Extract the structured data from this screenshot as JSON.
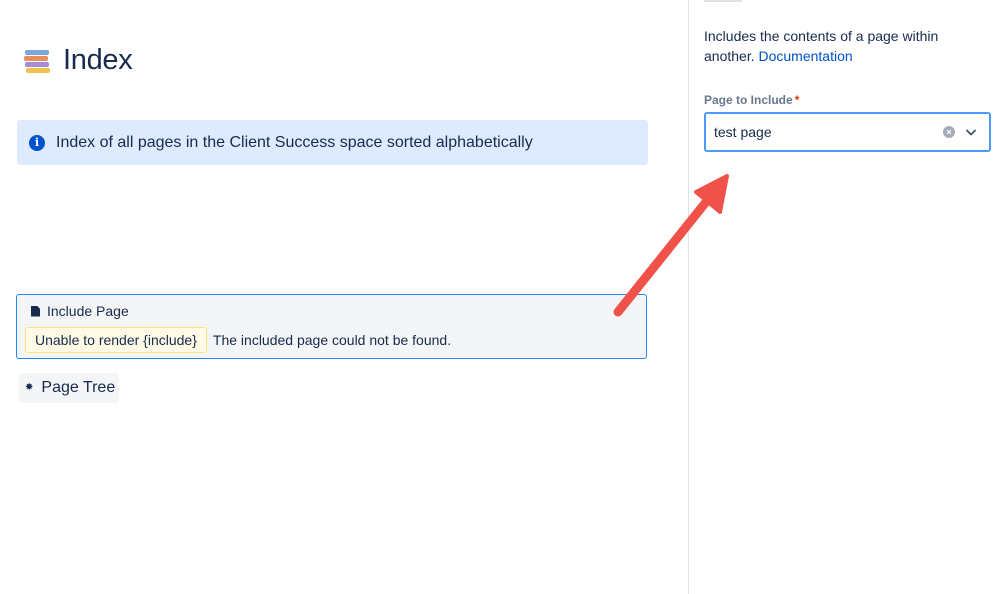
{
  "page": {
    "title": "Index"
  },
  "info_panel": {
    "text": "Index of all pages in the Client Success space sorted alphabetically"
  },
  "include_macro": {
    "title": "Include Page",
    "error_chip": "Unable to render {include}",
    "error_message": "The included page could not be found."
  },
  "pagetree_macro": {
    "label": "Page Tree"
  },
  "config_panel": {
    "description": "Includes the contents of a page within another.",
    "documentation_link": "Documentation",
    "field_label": "Page to Include",
    "required_marker": "*",
    "selected_value": "test page"
  },
  "colors": {
    "info_background": "#deebff",
    "info_icon": "#0052cc",
    "link": "#0052cc",
    "focus_border": "#4c9aff",
    "macro_border": "#2684ff",
    "error_chip_bg": "#fffae6",
    "required": "#de350b",
    "arrow": "#f0524a"
  },
  "icons": {
    "title_emoji": "books-icon",
    "info": "info-icon",
    "include_macro": "document-icon",
    "pagetree_macro": "puzzle-icon",
    "clear": "clear-icon",
    "dropdown": "chevron-down-icon"
  }
}
